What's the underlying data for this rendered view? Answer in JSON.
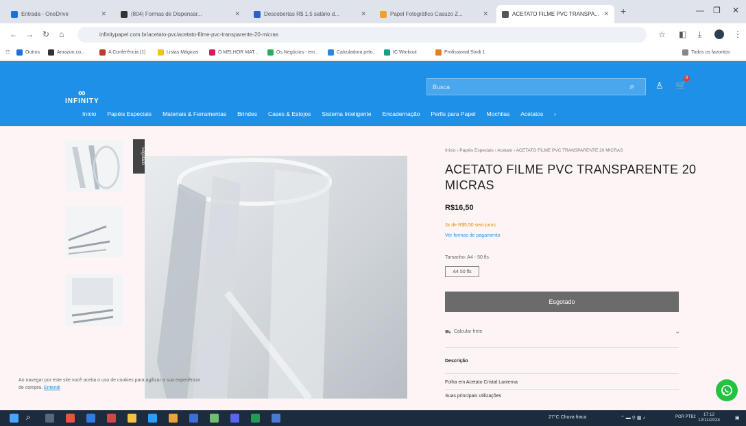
{
  "browser": {
    "tabs": [
      {
        "label": "Entrada - OneDrive",
        "color": "#1e6fd9"
      },
      {
        "label": "(804) Formas de Dispensar...",
        "color": "#333"
      },
      {
        "label": "Descobertas R$ 1,5 salário d...",
        "color": "#2a62c8"
      },
      {
        "label": "Papel Fotográfico Casuzo Z...",
        "color": "#f0a030"
      },
      {
        "label": "ACETATO FILME PVC TRANSPA...",
        "color": "#555"
      }
    ],
    "new_tab": "+",
    "url": "infinitypapel.com.br/acetato-pvc/acetato-filme-pvc-transparente-20-micras",
    "bookmarks": [
      {
        "label": "Outros",
        "color": "#1e6fd9"
      },
      {
        "label": "Amazon.co...",
        "color": "#333"
      },
      {
        "label": "A Conferência (1)",
        "color": "#c0392b"
      },
      {
        "label": "Listas Mágicas",
        "color": "#f1c40f"
      },
      {
        "label": "O MELHOR MAT...",
        "color": "#d81b60"
      },
      {
        "label": "Os Negócios - em...",
        "color": "#27ae60"
      },
      {
        "label": "Calculadora pelo...",
        "color": "#2e86de"
      },
      {
        "label": "IC Workout",
        "color": "#16a085"
      },
      {
        "label": "Profissional Sindi 1",
        "color": "#e67e22"
      },
      {
        "label": "Todos os favoritos",
        "color": "#888"
      }
    ]
  },
  "site": {
    "logo_symbol": "∞",
    "logo_name": "INFINITY",
    "search_placeholder": "Busca",
    "cart_count": "0",
    "menu": [
      "Início",
      "Papéis Especiais",
      "Materiais & Ferramentas",
      "Brindes",
      "Cases & Estojos",
      "Sistema Inteligente",
      "Encadernação",
      "Perfis para Papel",
      "Mochilas",
      "Acetatos",
      "›"
    ]
  },
  "product": {
    "badge": "Esgotado",
    "breadcrumb": "Início › Papéis Especiais › Acetato › ACETATO FILME PVC TRANSPARENTE 20 MICRAS",
    "title": "ACETATO FILME PVC TRANSPARENTE 20 MICRAS",
    "price": "R$16,50",
    "installments": "3x de R$5,50 sem juros",
    "payment_info": "Ver formas de pagamento",
    "size_label": "Tamanho: A4 - 50 fls",
    "size_option": "A4 50 fls",
    "button": "Esgotado",
    "shipping": "Calcular frete",
    "desc_title": "Descrição",
    "desc_line1": "Folha em Acetato Cristal Lanterna",
    "desc_line2": "Suas principais utilizações"
  },
  "cookie": {
    "text": "Ao navegar por este site você aceita o uso de cookies para agilizar a sua experiência de compra.",
    "link": "Entendi"
  },
  "taskbar": {
    "weather": "27°C Chuva fraca",
    "time": "17:12",
    "date": "12/11/2024",
    "lang": "POR PTB2"
  },
  "colors": {
    "brand": "#1e90e8",
    "button": "#6b6b6b",
    "whatsapp": "#25c23f"
  }
}
